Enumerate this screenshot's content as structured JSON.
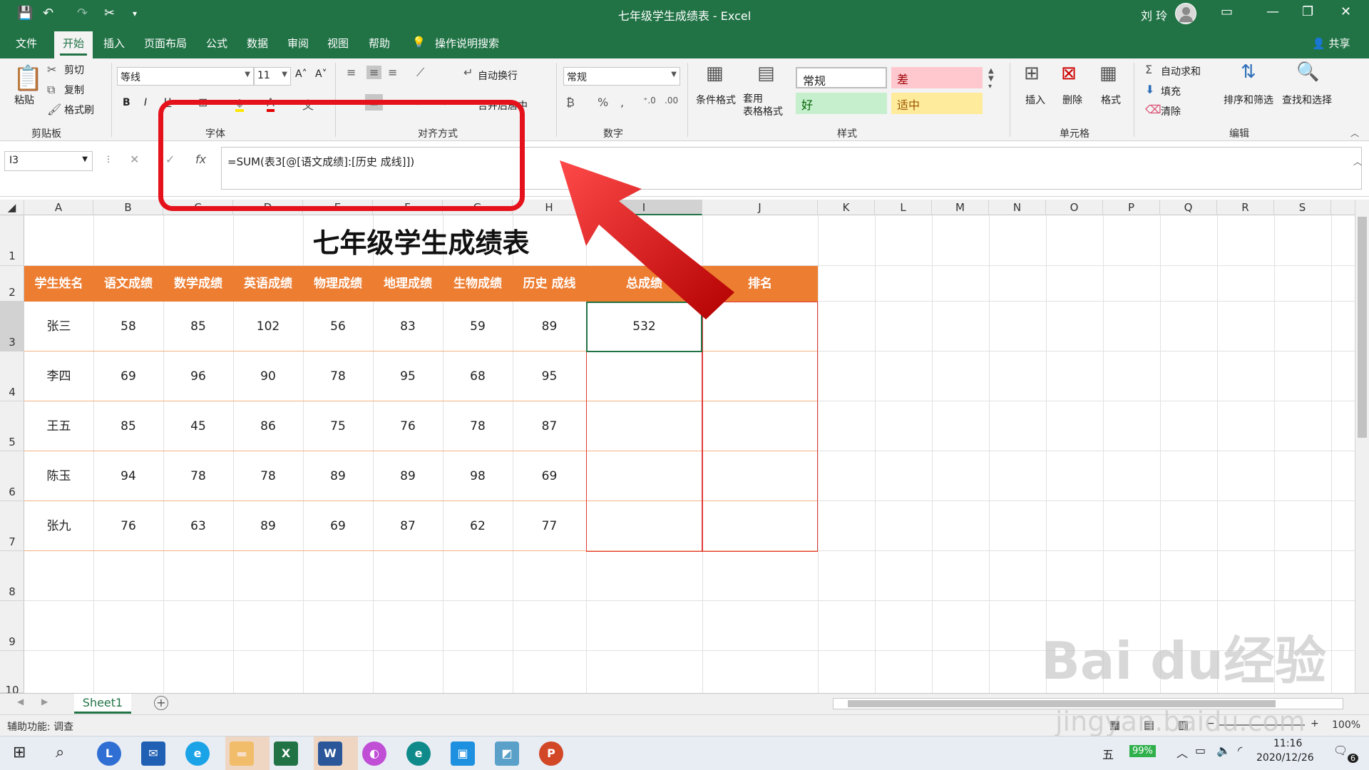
{
  "window": {
    "title": "七年级学生成绩表 - Excel",
    "user": "刘 玲"
  },
  "menu": [
    "文件",
    "开始",
    "插入",
    "页面布局",
    "公式",
    "数据",
    "审阅",
    "视图",
    "帮助",
    "操作说明搜索"
  ],
  "share_label": "共享",
  "ribbon": {
    "clipboard": {
      "paste": "粘贴",
      "cut": "剪切",
      "copy": "复制",
      "format_painter": "格式刷",
      "label": "剪贴板"
    },
    "font": {
      "name": "等线",
      "size": "11",
      "label": "字体"
    },
    "alignment": {
      "wrap": "自动换行",
      "merge": "合并后居中",
      "label": "对齐方式"
    },
    "number": {
      "format": "常规",
      "label": "数字"
    },
    "styles": {
      "conditional": "条件格式",
      "table": "套用\n表格格式",
      "normal": "常规",
      "bad": "差",
      "good": "好",
      "neutral": "适中",
      "label": "样式"
    },
    "cells": {
      "insert": "插入",
      "delete": "删除",
      "format": "格式",
      "label": "单元格"
    },
    "editing": {
      "autosum": "自动求和",
      "fill": "填充",
      "clear": "清除",
      "sort": "排序和筛选",
      "find": "查找和选择",
      "label": "编辑"
    }
  },
  "formula_bar": {
    "name_box": "I3",
    "formula": "=SUM(表3[@[语文成绩]:[历史 成线]])",
    "fx": "fx"
  },
  "columns": [
    "A",
    "B",
    "C",
    "D",
    "E",
    "F",
    "G",
    "H",
    "I",
    "J",
    "K",
    "L",
    "M",
    "N",
    "O",
    "P",
    "Q",
    "R",
    "S"
  ],
  "rows": [
    "1",
    "2",
    "3",
    "4",
    "5",
    "6",
    "7",
    "8",
    "9",
    "10"
  ],
  "sheet": {
    "title": "七年级学生成绩表",
    "headers": [
      "学生姓名",
      "语文成绩",
      "数学成绩",
      "英语成绩",
      "物理成绩",
      "地理成绩",
      "生物成绩",
      "历史 成线",
      "总成绩",
      "排名"
    ],
    "data": [
      [
        "张三",
        "58",
        "85",
        "102",
        "56",
        "83",
        "59",
        "89",
        "532",
        ""
      ],
      [
        "李四",
        "69",
        "96",
        "90",
        "78",
        "95",
        "68",
        "95",
        "",
        ""
      ],
      [
        "王五",
        "85",
        "45",
        "86",
        "75",
        "76",
        "78",
        "87",
        "",
        ""
      ],
      [
        "陈玉",
        "94",
        "78",
        "78",
        "89",
        "89",
        "98",
        "69",
        "",
        ""
      ],
      [
        "张九",
        "76",
        "63",
        "89",
        "69",
        "87",
        "62",
        "77",
        "",
        ""
      ]
    ]
  },
  "sheet_tab": "Sheet1",
  "status": {
    "accessibility": "辅助功能: 调查",
    "zoom": "100%"
  },
  "taskbar": {
    "time": "11:16",
    "date": "2020/12/26",
    "battery": "99%",
    "ime": "五",
    "notifications": "6"
  },
  "watermark": {
    "brand": "Bai du经验",
    "url": "jingyan.baidu.com"
  },
  "colors": {
    "excel_green": "#217346",
    "header_orange": "#ed7d31",
    "annotation_red": "#e5111b"
  }
}
